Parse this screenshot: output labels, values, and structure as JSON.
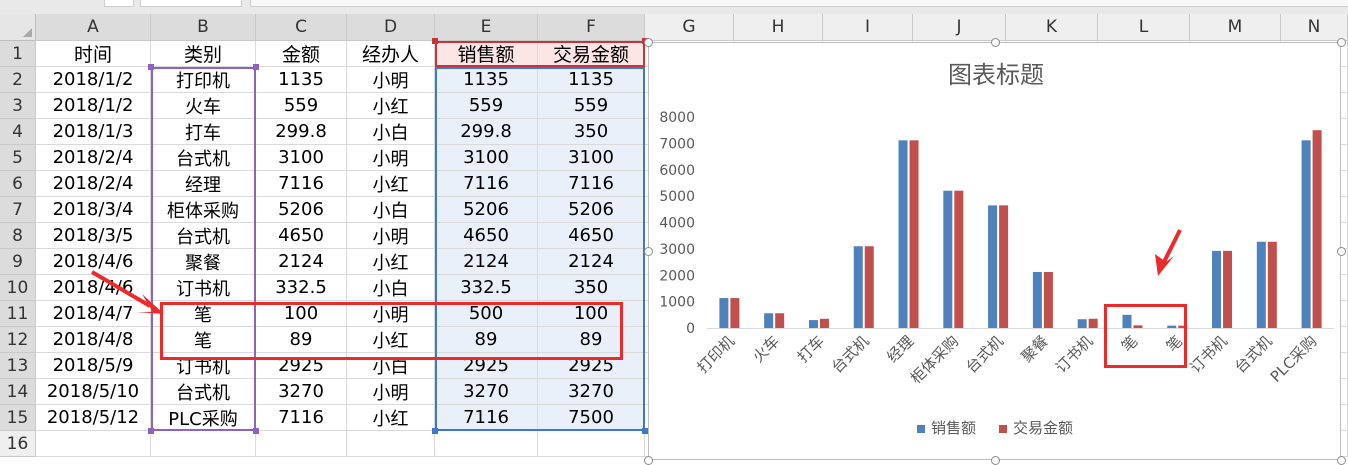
{
  "columns": [
    "A",
    "B",
    "C",
    "D",
    "E",
    "F",
    "G",
    "H",
    "I",
    "J",
    "K",
    "L",
    "M",
    "N"
  ],
  "rows": [
    "1",
    "2",
    "3",
    "4",
    "5",
    "6",
    "7",
    "8",
    "9",
    "10",
    "11",
    "12",
    "13",
    "14",
    "15",
    "16"
  ],
  "header": [
    "时间",
    "类别",
    "金额",
    "经办人",
    "销售额",
    "交易金额"
  ],
  "table": [
    [
      "2018/1/2",
      "打印机",
      "1135",
      "小明",
      "1135",
      "1135"
    ],
    [
      "2018/1/2",
      "火车",
      "559",
      "小红",
      "559",
      "559"
    ],
    [
      "2018/1/3",
      "打车",
      "299.8",
      "小白",
      "299.8",
      "350"
    ],
    [
      "2018/2/4",
      "台式机",
      "3100",
      "小明",
      "3100",
      "3100"
    ],
    [
      "2018/2/4",
      "经理",
      "7116",
      "小红",
      "7116",
      "7116"
    ],
    [
      "2018/3/4",
      "柜体采购",
      "5206",
      "小白",
      "5206",
      "5206"
    ],
    [
      "2018/3/5",
      "台式机",
      "4650",
      "小明",
      "4650",
      "4650"
    ],
    [
      "2018/4/6",
      "聚餐",
      "2124",
      "小红",
      "2124",
      "2124"
    ],
    [
      "2018/4/6",
      "订书机",
      "332.5",
      "小白",
      "332.5",
      "350"
    ],
    [
      "2018/4/7",
      "笔",
      "100",
      "小明",
      "500",
      "100"
    ],
    [
      "2018/4/8",
      "笔",
      "89",
      "小红",
      "89",
      "89"
    ],
    [
      "2018/5/9",
      "订书机",
      "2925",
      "小白",
      "2925",
      "2925"
    ],
    [
      "2018/5/10",
      "台式机",
      "3270",
      "小明",
      "3270",
      "3270"
    ],
    [
      "2018/5/12",
      "PLC采购",
      "7116",
      "小红",
      "7116",
      "7500"
    ]
  ],
  "colors": {
    "series1": "#4f81bd",
    "series2": "#c0504d",
    "annotation": "#ea2b2b",
    "rangeB": "#8e63c0",
    "rangeEF": "#3f78c8",
    "rangeEFHeader": "#c8323a"
  },
  "chart_data": {
    "type": "bar",
    "title": "图表标题",
    "categories": [
      "打印机",
      "火车",
      "打车",
      "台式机",
      "经理",
      "柜体采购",
      "台式机",
      "聚餐",
      "订书机",
      "笔",
      "笔",
      "订书机",
      "台式机",
      "PLC采购"
    ],
    "series": [
      {
        "name": "销售额",
        "values": [
          1135,
          559,
          299.8,
          3100,
          7116,
          5206,
          4650,
          2124,
          332.5,
          500,
          89,
          2925,
          3270,
          7116
        ]
      },
      {
        "name": "交易金额",
        "values": [
          1135,
          559,
          350,
          3100,
          7116,
          5206,
          4650,
          2124,
          350,
          100,
          89,
          2925,
          3270,
          7500
        ]
      }
    ],
    "yticks": [
      "0",
      "1000",
      "2000",
      "3000",
      "4000",
      "5000",
      "6000",
      "7000",
      "8000"
    ],
    "ylim": [
      0,
      8000
    ],
    "grid": false,
    "legend": "bottom"
  }
}
